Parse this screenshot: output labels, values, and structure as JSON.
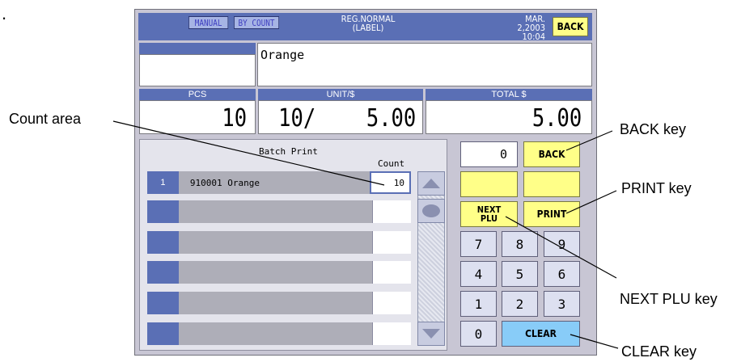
{
  "marker": ".",
  "topbar": {
    "mode_manual": "MANUAL",
    "mode_by_count": "BY COUNT",
    "reg_line1": "REG.NORMAL",
    "reg_line2": "(LABEL)",
    "date": "MAR. 2,2003",
    "time": "10:04",
    "back_label": "BACK"
  },
  "item": {
    "name": "Orange"
  },
  "values": {
    "pcs_label": "PCS",
    "pcs_value": "10",
    "unit_label": "UNIT/$",
    "unit_value": "10/",
    "unit_price": "5.00",
    "total_label": "TOTAL $",
    "total_value": "5.00"
  },
  "batch": {
    "title": "Batch Print",
    "count_header": "Count",
    "rows": [
      {
        "num": "1",
        "name": "910001 Orange",
        "count": "10"
      },
      {
        "num": "",
        "name": "",
        "count": ""
      },
      {
        "num": "",
        "name": "",
        "count": ""
      },
      {
        "num": "",
        "name": "",
        "count": ""
      },
      {
        "num": "",
        "name": "",
        "count": ""
      },
      {
        "num": "",
        "name": "",
        "count": ""
      }
    ]
  },
  "keypad": {
    "display": "0",
    "back": "BACK",
    "next_plu_line1": "NEXT",
    "next_plu_line2": "PLU",
    "print": "PRINT",
    "keys": [
      "7",
      "8",
      "9",
      "4",
      "5",
      "6",
      "1",
      "2",
      "3",
      "0"
    ],
    "clear": "CLEAR"
  },
  "callouts": {
    "count_area": "Count area",
    "back_key": "BACK key",
    "print_key": "PRINT key",
    "next_plu_key": "NEXT PLU key",
    "clear_key": "CLEAR key"
  },
  "colors": {
    "header_blue": "#5a6fb5",
    "key_yellow": "#ffff88",
    "clear_blue": "#88ccf8",
    "panel_gray": "#c8c6d4"
  }
}
